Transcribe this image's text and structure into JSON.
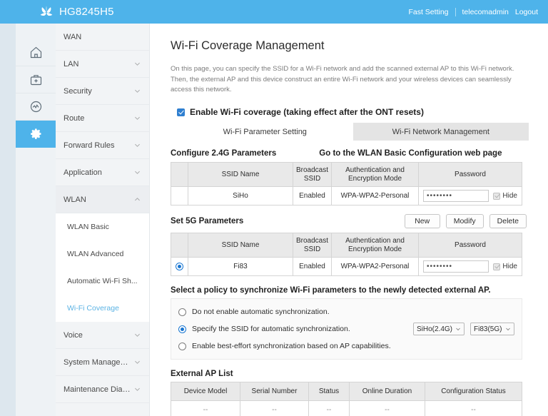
{
  "header": {
    "logo_icon": "huawei-flower-logo",
    "product": "HG8245H5",
    "fast_setting": "Fast Setting",
    "username": "telecomadmin",
    "logout": "Logout"
  },
  "rail": {
    "items": [
      {
        "icon": "home-icon",
        "name": "home",
        "active": false
      },
      {
        "icon": "first-aid-kit-icon",
        "name": "diagnosis",
        "active": false
      },
      {
        "icon": "gauge-icon",
        "name": "status",
        "active": false
      },
      {
        "icon": "gear-icon",
        "name": "settings",
        "active": true
      }
    ]
  },
  "menu": {
    "items": [
      {
        "label": "WAN",
        "expandable": false
      },
      {
        "label": "LAN",
        "expandable": true,
        "expanded": false
      },
      {
        "label": "Security",
        "expandable": true,
        "expanded": false
      },
      {
        "label": "Route",
        "expandable": true,
        "expanded": false
      },
      {
        "label": "Forward Rules",
        "expandable": true,
        "expanded": false
      },
      {
        "label": "Application",
        "expandable": true,
        "expanded": false
      },
      {
        "label": "WLAN",
        "expandable": true,
        "expanded": true
      }
    ],
    "wlan_children": [
      {
        "label": "WLAN Basic",
        "active": false
      },
      {
        "label": "WLAN Advanced",
        "active": false
      },
      {
        "label": "Automatic Wi-Fi Sh...",
        "active": false
      },
      {
        "label": "Wi-Fi Coverage",
        "active": true
      }
    ],
    "tail_items": [
      {
        "label": "Voice",
        "expandable": true
      },
      {
        "label": "System Management",
        "expandable": true
      },
      {
        "label": "Maintenance Diagno..",
        "expandable": true
      }
    ]
  },
  "page": {
    "title": "Wi-Fi Coverage Management",
    "intro": "On this page, you can specify the SSID for a Wi-Fi network and add the scanned external AP to this Wi-Fi network. Then, the external AP and this device construct an entire Wi-Fi network and your wireless devices can seamlessly access this network.",
    "enable_label": "Enable Wi-Fi coverage (taking effect after the ONT resets)",
    "enable_checked": true,
    "tabs": [
      {
        "label": "Wi-Fi Parameter Setting",
        "active": true
      },
      {
        "label": "Wi-Fi Network Management",
        "active": false
      }
    ]
  },
  "section_24g": {
    "title": "Configure 2.4G Parameters",
    "link": "Go to the WLAN Basic Configuration web page",
    "columns": [
      "",
      "SSID Name",
      "Broadcast SSID",
      "Authentication and Encryption Mode",
      "Password"
    ],
    "col_broadcast_line1": "Broadcast",
    "col_broadcast_line2": "SSID",
    "col_auth_line1": "Authentication and",
    "col_auth_line2": "Encryption Mode",
    "rows": [
      {
        "selected": false,
        "ssid": "SiHo",
        "broadcast": "Enabled",
        "auth": "WPA-WPA2-Personal",
        "password_mask": "••••••••",
        "hide_label": "Hide",
        "hide_checked": true
      }
    ]
  },
  "section_5g": {
    "title": "Set 5G Parameters",
    "buttons": [
      "New",
      "Modify",
      "Delete"
    ],
    "col_broadcast_line1": "Broadcast",
    "col_broadcast_line2": "SSID",
    "col_auth_line1": "Authentication and",
    "col_auth_line2": "Encryption Mode",
    "col_ssid": "SSID Name",
    "col_password": "Password",
    "rows": [
      {
        "selected": true,
        "ssid": "Fi83",
        "broadcast": "Enabled",
        "auth": "WPA-WPA2-Personal",
        "password_mask": "••••••••",
        "hide_label": "Hide",
        "hide_checked": true
      }
    ]
  },
  "policy": {
    "title": "Select a policy to synchronize Wi-Fi parameters to the newly detected external AP.",
    "options": [
      {
        "label": "Do not enable automatic synchronization.",
        "selected": false
      },
      {
        "label": "Specify the SSID for automatic synchronization.",
        "selected": true
      },
      {
        "label": "Enable best-effort synchronization based on AP capabilities.",
        "selected": false
      }
    ],
    "select_24g": "SiHo(2.4G)",
    "select_5g": "Fi83(5G)"
  },
  "external_ap": {
    "title": "External AP List",
    "columns": [
      "Device Model",
      "Serial Number",
      "Status",
      "Online Duration",
      "Configuration Status"
    ],
    "rows": [
      {
        "device_model": "--",
        "serial": "--",
        "status": "--",
        "online": "--",
        "config": "--"
      }
    ]
  },
  "colors": {
    "brand_blue": "#4eb3ea",
    "accent_link": "#5bb3e4",
    "checkbox_blue": "#2f7fd0",
    "radio_blue": "#1775d1",
    "header_gray": "#e9e9e9",
    "tab_inactive": "#e4e4e4"
  }
}
